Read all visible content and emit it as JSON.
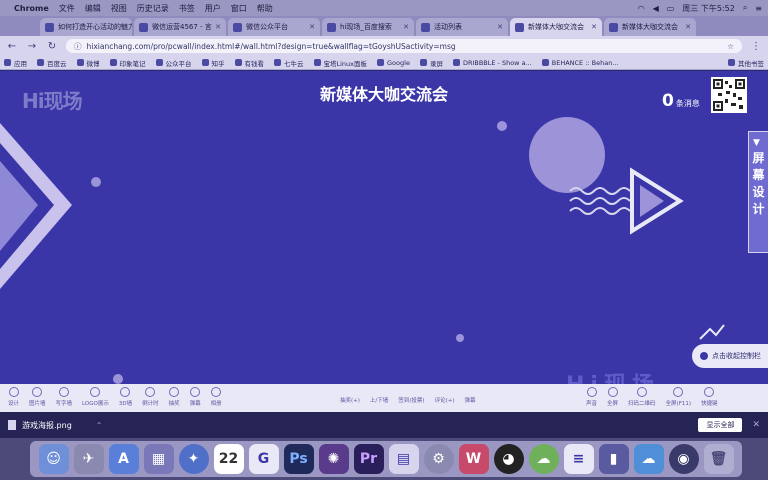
{
  "menubar": {
    "app": "Chrome",
    "items": [
      "文件",
      "编辑",
      "视图",
      "历史记录",
      "书签",
      "用户",
      "窗口",
      "帮助"
    ],
    "clock": "周三 下午5:52"
  },
  "tabs": [
    {
      "title": "如何打造开心活动的魅力",
      "active": false
    },
    {
      "title": "微信运营4567 - 言",
      "active": false
    },
    {
      "title": "微信公众平台",
      "active": false
    },
    {
      "title": "hi现场_百度搜索",
      "active": false
    },
    {
      "title": "活动列表",
      "active": false
    },
    {
      "title": "新媒体大咖交流会",
      "active": true
    },
    {
      "title": "新媒体大咖交流会",
      "active": false
    }
  ],
  "address": {
    "url": "hixianchang.com/pro/pcwall/index.html#/wall.html?design=true&wallflag=tGoyshUSactivity=msg"
  },
  "bookmarks": [
    "应用",
    "百度云",
    "微博",
    "印象笔记",
    "公众平台",
    "知乎",
    "有钱看",
    "七牛云",
    "宝塔Linux面板",
    "Google",
    "录屏",
    "DRIBBBLE - Show a...",
    "BEHANCE :: Behan..."
  ],
  "bookmarks_other": "其他书签",
  "page": {
    "logo": "Hi现场",
    "title": "新媒体大咖交流会",
    "msg_count": "0",
    "msg_label": "条消息",
    "side_button": [
      "屏",
      "幕",
      "设",
      "计"
    ],
    "control_tip": "点击收起控制栏",
    "watermark": "Hi现场"
  },
  "toolbar": {
    "left": [
      "设计",
      "图片墙",
      "写字墙",
      "LOGO展示",
      "3D墙",
      "倒计时",
      "抽奖",
      "弹幕",
      "相册"
    ],
    "middle": [
      "抽奖(+)",
      "上/下墙",
      "签到(投票)",
      "评论(+)",
      "弹幕"
    ],
    "right": [
      "声音",
      "全屏",
      "扫码二维码",
      "全屏(F11)",
      "快捷键"
    ]
  },
  "download": {
    "filename": "游戏海报.png",
    "show_all": "显示全部"
  },
  "dock": {
    "items": [
      "finder-icon",
      "launchpad-icon",
      "appstore-icon",
      "preview-icon",
      "safari-icon",
      "calendar-icon",
      "chrome-icon",
      "photoshop-icon",
      "illustrator-icon",
      "premiere-icon",
      "keynote-icon",
      "systemprefs-icon",
      "wps-icon",
      "qq-icon",
      "wechat-icon",
      "notes-icon",
      "screenflow-icon",
      "baiduyun-icon",
      "quicktime-icon",
      "trash-icon"
    ],
    "calendar_day": "22",
    "ps_label": "Ps",
    "pr_label": "Pr"
  },
  "colors": {
    "page_bg": "#3a36a8",
    "accent": "#6f6bd0",
    "circle_large": "#9c93d8",
    "triangle": "#c9c2ec"
  }
}
